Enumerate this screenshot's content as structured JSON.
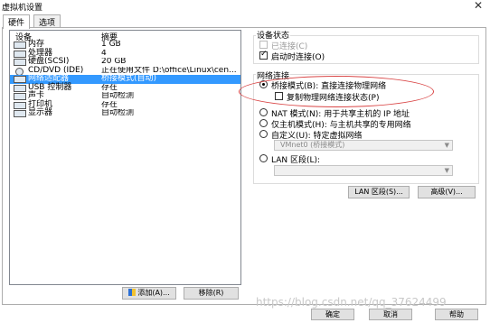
{
  "window": {
    "title": "虚拟机设置",
    "close_glyph": "✕"
  },
  "tabs": [
    {
      "label": "硬件"
    },
    {
      "label": "选项"
    }
  ],
  "device_list": {
    "headers": {
      "device": "设备",
      "summary": "摘要"
    },
    "rows": [
      {
        "device": "内存",
        "summary": "1 GB"
      },
      {
        "device": "处理器",
        "summary": "4"
      },
      {
        "device": "硬盘(SCSI)",
        "summary": "20 GB"
      },
      {
        "device": "CD/DVD (IDE)",
        "summary": "正在使用文件 D:\\office\\Linux\\cen..."
      },
      {
        "device": "网络适配器",
        "summary": "桥接模式(自动)",
        "selected": true
      },
      {
        "device": "USB 控制器",
        "summary": "存在"
      },
      {
        "device": "声卡",
        "summary": "自动检测"
      },
      {
        "device": "打印机",
        "summary": "存在"
      },
      {
        "device": "显示器",
        "summary": "自动检测"
      }
    ]
  },
  "buttons": {
    "add": "添加(A)...",
    "remove": "移除(R)",
    "lan_segments": "LAN 区段(S)...",
    "advanced": "高级(V)...",
    "ok": "确定",
    "cancel": "取消",
    "help": "帮助"
  },
  "device_status": {
    "group_label": "设备状态",
    "connected": {
      "label": "已连接(C)",
      "checked": false,
      "disabled": true
    },
    "connect_on_power": {
      "label": "启动时连接(O)",
      "checked": true
    }
  },
  "network": {
    "group_label": "网络连接",
    "bridged": {
      "label": "桥接模式(B): 直接连接物理网络",
      "checked": true
    },
    "replicate": {
      "label": "复制物理网络连接状态(P)",
      "checked": false
    },
    "nat": {
      "label": "NAT 模式(N): 用于共享主机的 IP 地址"
    },
    "host_only": {
      "label": "仅主机模式(H): 与主机共享的专用网络"
    },
    "custom": {
      "label": "自定义(U): 特定虚拟网络",
      "select_value": "VMnet0 (桥接模式)"
    },
    "lan_segment": {
      "label": "LAN 区段(L):",
      "select_value": ""
    }
  },
  "watermark": "https://blog.csdn.net/qq_37624499",
  "colors": {
    "selection": "#3399ff",
    "highlight_ellipse": "#d94545"
  }
}
